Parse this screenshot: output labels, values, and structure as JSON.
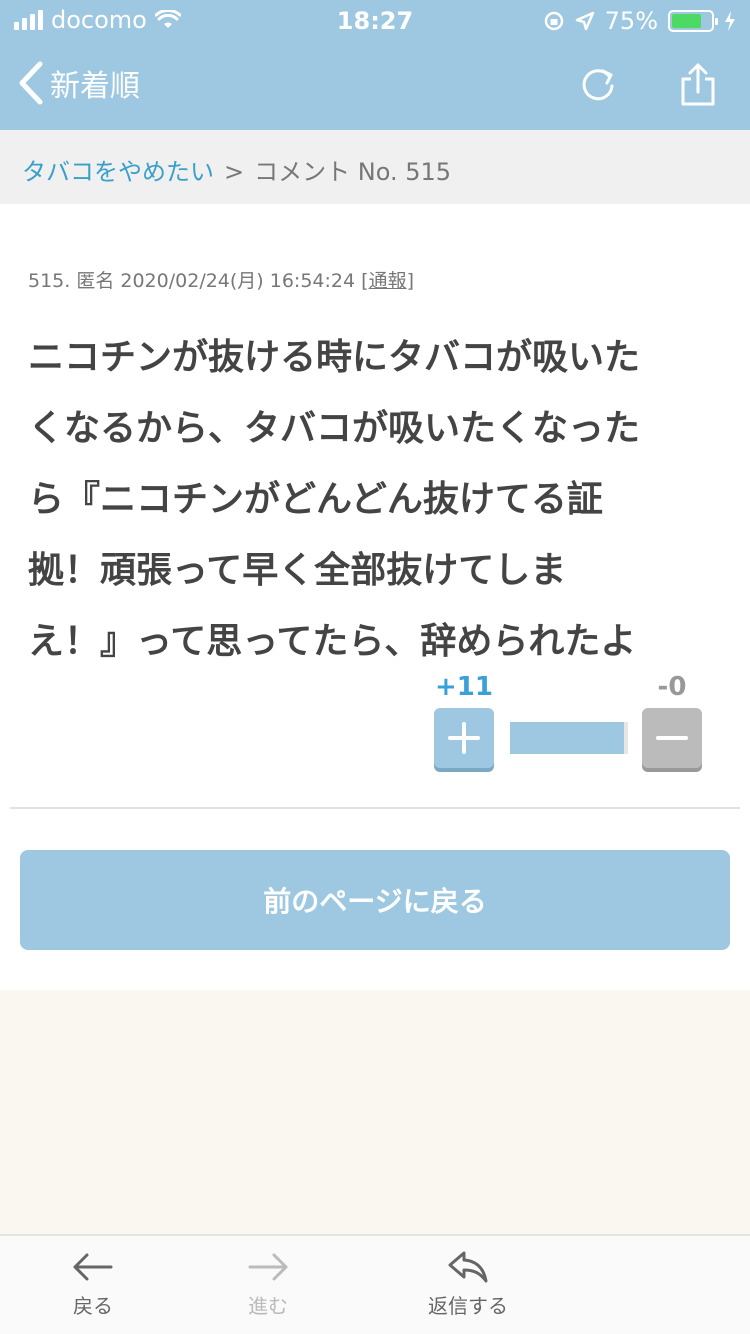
{
  "status_bar": {
    "carrier": "docomo",
    "time": "18:27",
    "battery": "75%"
  },
  "nav": {
    "back_label": "新着順"
  },
  "breadcrumb": {
    "topic": "タバコをやめたい",
    "separator": ">",
    "current": "コメント No. 515"
  },
  "comment": {
    "meta": "515. 匿名 2020/02/24(月) 16:54:24",
    "report_open": "[",
    "report": "通報",
    "report_close": "]",
    "lines": [
      "ニコチンが抜ける時にタバコが吸いた",
      "くなるから、タバコが吸いたくなった",
      "ら『ニコチンがどんどん抜けてる証",
      "拠！頑張って早く全部抜けてしま",
      "え！』って思ってたら、辞められたよ"
    ]
  },
  "votes": {
    "plus": "+11",
    "minus": "-0",
    "plus_ratio": 0.97
  },
  "back_page_button": "前のページに戻る",
  "tab_bar": {
    "back": "戻る",
    "forward": "進む",
    "reply": "返信する"
  },
  "colors": {
    "theme": "#9ec8e1",
    "link": "#3aa0c8",
    "plus": "#3aa0d8"
  }
}
